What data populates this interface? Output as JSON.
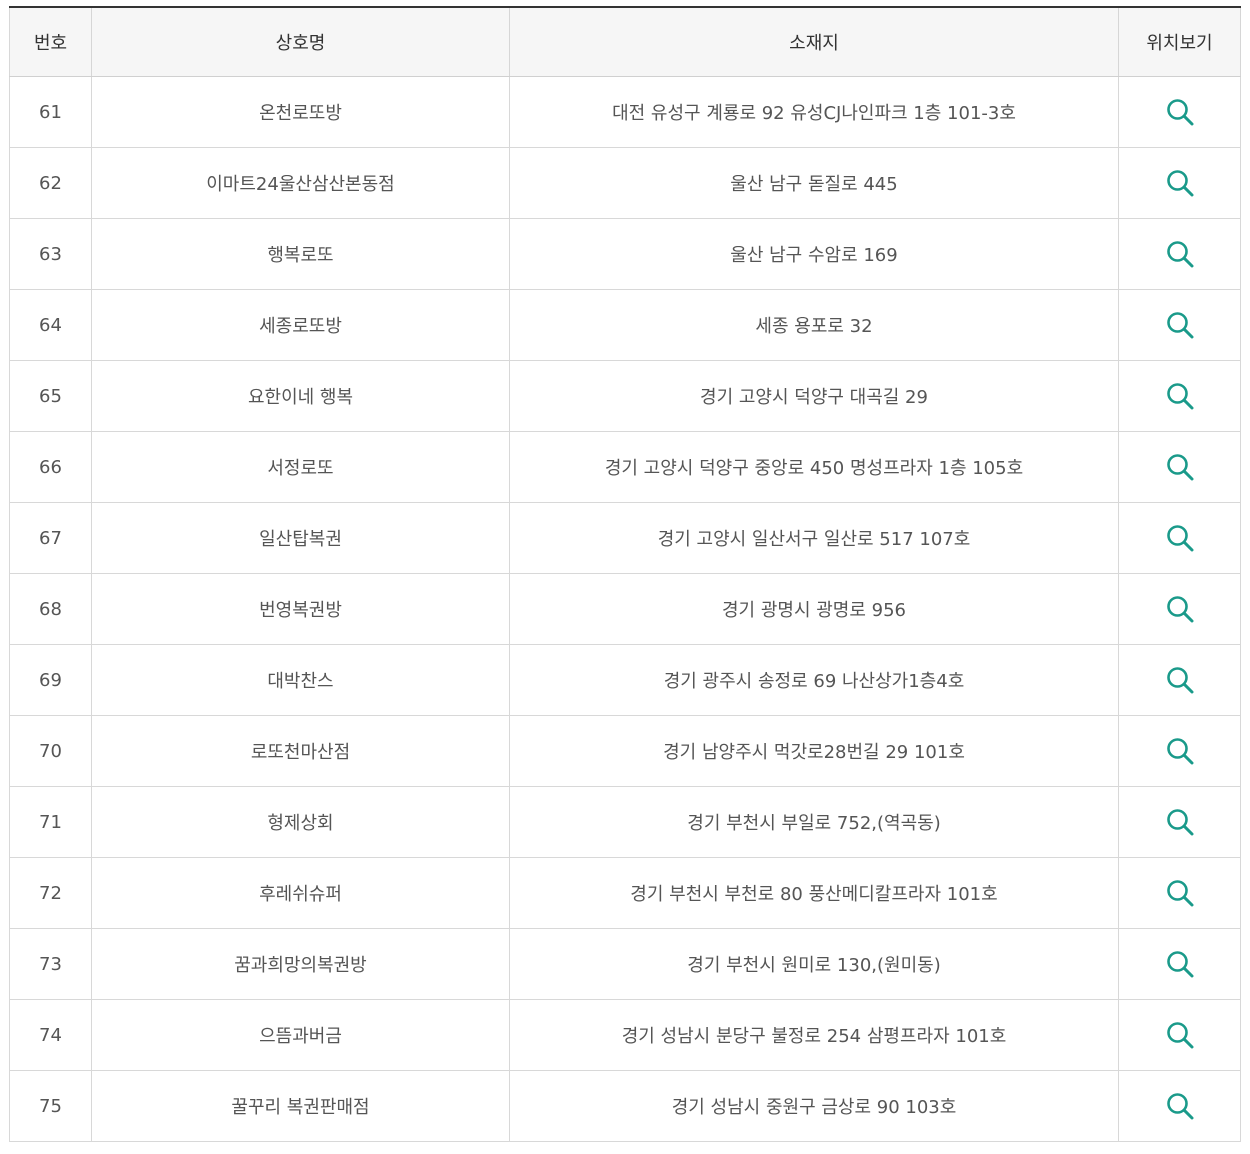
{
  "table": {
    "headers": {
      "number": "번호",
      "name": "상호명",
      "address": "소재지",
      "location": "위치보기"
    },
    "icon": "search-icon",
    "icon_color": "#1a9a8a",
    "rows": [
      {
        "number": "61",
        "name": "온천로또방",
        "address": "대전 유성구 계룡로 92 유성CJ나인파크 1층 101-3호"
      },
      {
        "number": "62",
        "name": "이마트24울산삼산본동점",
        "address": "울산 남구 돋질로 445"
      },
      {
        "number": "63",
        "name": "행복로또",
        "address": "울산 남구 수암로 169"
      },
      {
        "number": "64",
        "name": "세종로또방",
        "address": "세종 용포로 32"
      },
      {
        "number": "65",
        "name": "요한이네 행복",
        "address": "경기 고양시 덕양구 대곡길 29"
      },
      {
        "number": "66",
        "name": "서정로또",
        "address": "경기 고양시 덕양구 중앙로 450 명성프라자 1층 105호"
      },
      {
        "number": "67",
        "name": "일산탑복권",
        "address": "경기 고양시 일산서구 일산로 517 107호"
      },
      {
        "number": "68",
        "name": "번영복권방",
        "address": "경기 광명시 광명로 956"
      },
      {
        "number": "69",
        "name": "대박찬스",
        "address": "경기 광주시 송정로 69 나산상가1층4호"
      },
      {
        "number": "70",
        "name": "로또천마산점",
        "address": "경기 남양주시 먹갓로28번길 29 101호"
      },
      {
        "number": "71",
        "name": "형제상회",
        "address": "경기 부천시 부일로 752,(역곡동)"
      },
      {
        "number": "72",
        "name": "후레쉬슈퍼",
        "address": "경기 부천시 부천로 80 풍산메디칼프라자 101호"
      },
      {
        "number": "73",
        "name": "꿈과희망의복권방",
        "address": "경기 부천시 원미로 130,(원미동)"
      },
      {
        "number": "74",
        "name": "으뜸과버금",
        "address": "경기 성남시 분당구 불정로 254 삼평프라자 101호"
      },
      {
        "number": "75",
        "name": "꿀꾸리 복권판매점",
        "address": "경기 성남시 중원구 금상로 90 103호"
      }
    ]
  }
}
